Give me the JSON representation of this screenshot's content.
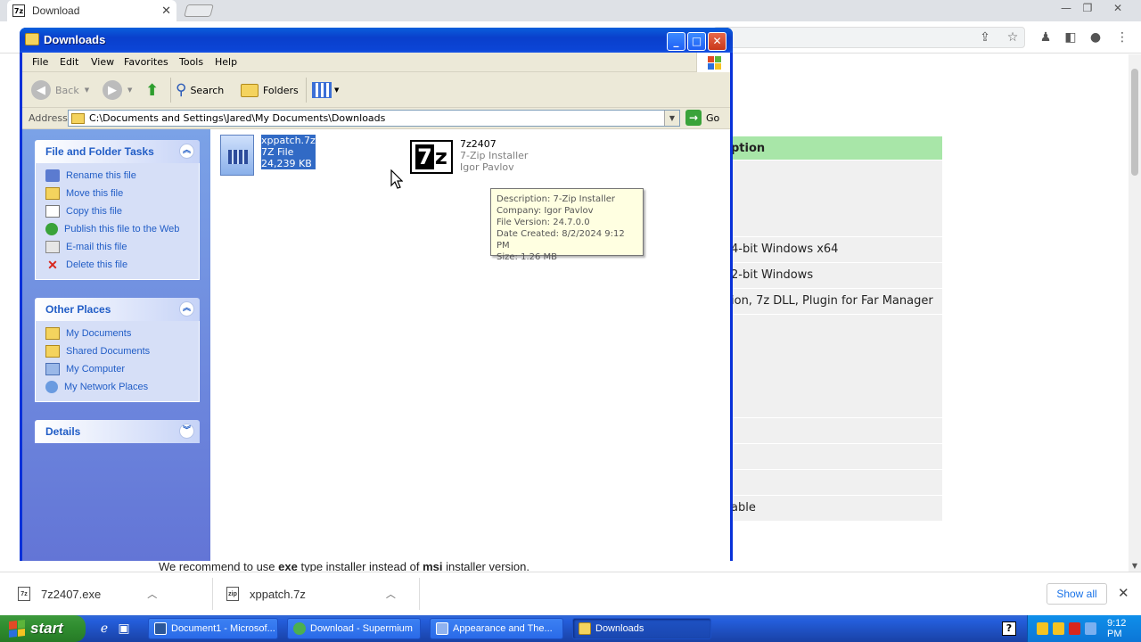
{
  "browser": {
    "tab_title": "Download",
    "tab_close": "✕",
    "tab_favicon_text": "7z",
    "accent": "#1a73e8",
    "window_controls": [
      "—",
      "❐",
      "✕"
    ]
  },
  "webpage": {
    "table_header": "ption",
    "rows": [
      "",
      "4-bit Windows x64",
      "2-bit Windows",
      "ion, 7z DLL, Plugin for Far Manager",
      "",
      "",
      "",
      "",
      "able"
    ],
    "note_pre": "We recommend to use ",
    "note_b1": "exe",
    "note_mid": " type installer instead of ",
    "note_b2": "msi",
    "note_post": " installer version."
  },
  "download_bar": {
    "items": [
      {
        "icon_text": "7z",
        "name": "7z2407.exe"
      },
      {
        "icon_text": "zip",
        "name": "xppatch.7z"
      }
    ],
    "show_all": "Show all",
    "close": "✕"
  },
  "explorer": {
    "title": "Downloads",
    "menu": [
      "File",
      "Edit",
      "View",
      "Favorites",
      "Tools",
      "Help"
    ],
    "toolbar": {
      "back": "Back",
      "search": "Search",
      "folders": "Folders"
    },
    "address_label": "Address",
    "address_path": "C:\\Documents and Settings\\Jared\\My Documents\\Downloads",
    "go": "Go",
    "panels": {
      "tasks": {
        "title": "File and Folder Tasks",
        "items": [
          "Rename this file",
          "Move this file",
          "Copy this file",
          "Publish this file to the Web",
          "E-mail this file",
          "Delete this file"
        ]
      },
      "places": {
        "title": "Other Places",
        "items": [
          "My Documents",
          "Shared Documents",
          "My Computer",
          "My Network Places"
        ]
      },
      "details": {
        "title": "Details"
      }
    },
    "files": [
      {
        "name": "xppatch.7z",
        "type": "7Z File",
        "size": "24,239 KB"
      },
      {
        "name": "7z2407",
        "type": "7-Zip Installer",
        "company": "Igor Pavlov",
        "icon_text": "7z"
      }
    ],
    "tooltip": [
      "Description: 7-Zip Installer",
      "Company: Igor Pavlov",
      "File Version: 24.7.0.0",
      "Date Created: 8/2/2024 9:12 PM",
      "Size: 1.26 MB"
    ]
  },
  "taskbar": {
    "start": "start",
    "buttons": [
      {
        "label": "Document1 - Microsof..."
      },
      {
        "label": "Download - Supermium"
      },
      {
        "label": "Appearance and The..."
      },
      {
        "label": "Downloads"
      }
    ],
    "clock": "9:12 PM"
  }
}
